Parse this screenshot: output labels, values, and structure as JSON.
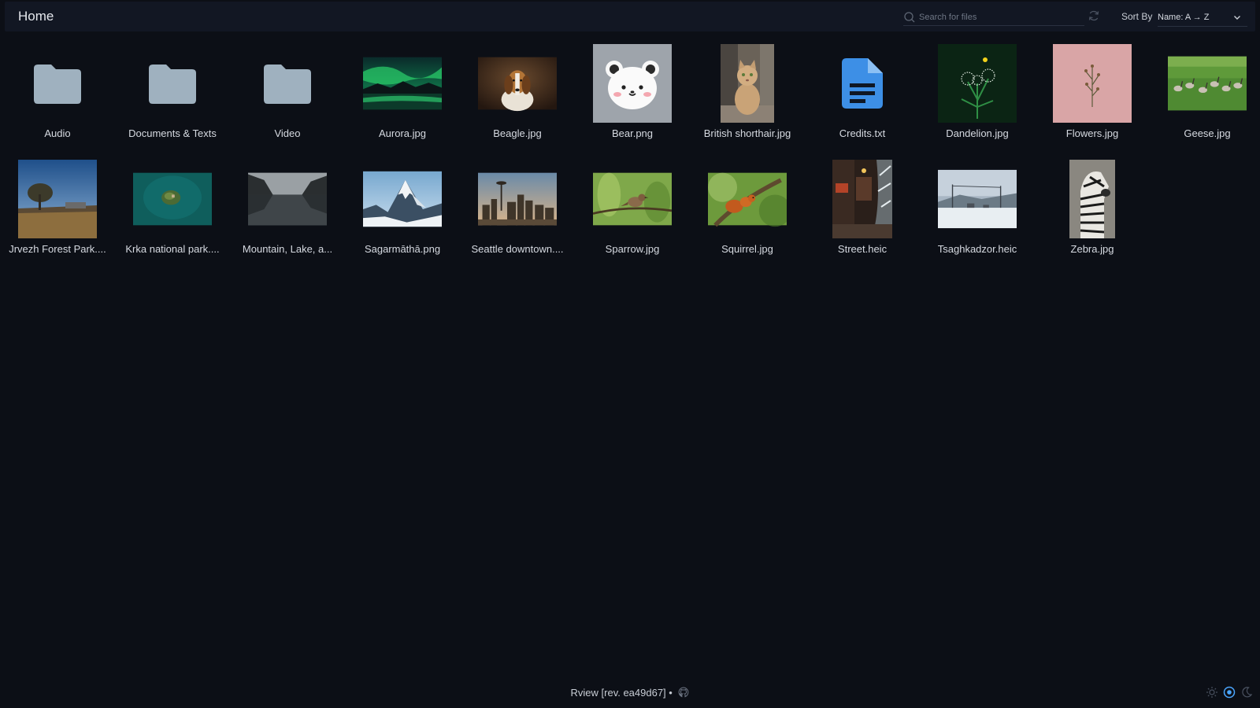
{
  "header": {
    "breadcrumb": "Home",
    "search_placeholder": "Search for files",
    "sort_label": "Sort By",
    "sort_value": "Name: A → Z"
  },
  "items": [
    {
      "label": "Audio",
      "kind": "folder"
    },
    {
      "label": "Documents & Texts",
      "kind": "folder"
    },
    {
      "label": "Video",
      "kind": "folder"
    },
    {
      "label": "Aurora.jpg",
      "kind": "image"
    },
    {
      "label": "Beagle.jpg",
      "kind": "image"
    },
    {
      "label": "Bear.png",
      "kind": "image"
    },
    {
      "label": "British shorthair.jpg",
      "kind": "image"
    },
    {
      "label": "Credits.txt",
      "kind": "text"
    },
    {
      "label": "Dandelion.jpg",
      "kind": "image"
    },
    {
      "label": "Flowers.jpg",
      "kind": "image"
    },
    {
      "label": "Geese.jpg",
      "kind": "image"
    },
    {
      "label": "Jrvezh Forest Park....",
      "kind": "image"
    },
    {
      "label": "Krka national park....",
      "kind": "image"
    },
    {
      "label": "Mountain, Lake, a...",
      "kind": "image"
    },
    {
      "label": "Sagarmāthā.png",
      "kind": "image"
    },
    {
      "label": "Seattle downtown....",
      "kind": "image"
    },
    {
      "label": "Sparrow.jpg",
      "kind": "image"
    },
    {
      "label": "Squirrel.jpg",
      "kind": "image"
    },
    {
      "label": "Street.heic",
      "kind": "image"
    },
    {
      "label": "Tsaghkadzor.heic",
      "kind": "image"
    },
    {
      "label": "Zebra.jpg",
      "kind": "image"
    }
  ],
  "footer": {
    "app_info": "Rview [rev. ea49d67] •"
  },
  "colors": {
    "background": "#0c0f16",
    "header": "#121723",
    "folder": "#9fb1bf",
    "text_file": "#3d8fe6",
    "accent": "#4aa6ff"
  }
}
